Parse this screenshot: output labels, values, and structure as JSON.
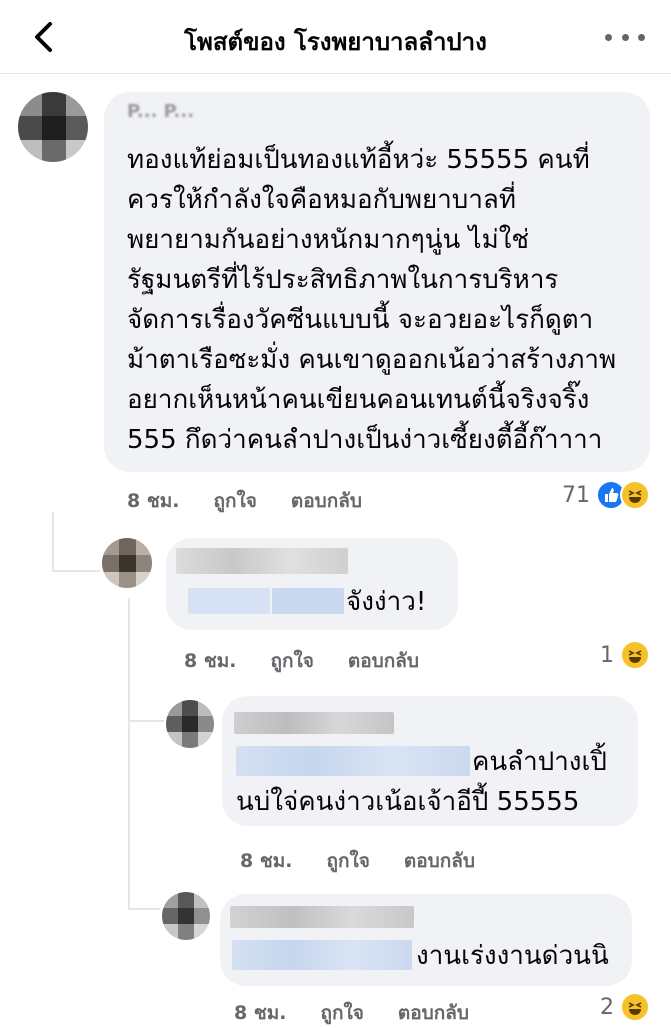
{
  "header": {
    "title": "โพสต์ของ โรงพยาบาลลำปาง",
    "back_icon": "back-chevron-icon",
    "more_icon": "more-dots-icon"
  },
  "comments": [
    {
      "author": "P... P...",
      "lines": [
        "ทองแท้ย่อมเป็นทองแท้อี้หว่ะ 55555 คนที่",
        "ควรให้กำลังใจคือหมอกับพยาบาลที่",
        "พยายามกันอย่างหนักมากๆนู่น ไม่ใช่",
        "รัฐมนตรีที่ไร้ประสิทธิภาพในการบริหาร",
        "จัดการเรื่องวัคซีนแบบนี้ จะอวยอะไรก็ดูตา",
        "ม้าตาเรือซะมั่ง คนเขาดูออกเน้อว่าสร้างภาพ",
        "อยากเห็นหน้าคนเขียนคอนเทนต์นี้จริงจริ๊ง",
        "555 กึดว่าคนลำปางเป็นง่าวเซี้ยงตี้อี้ก๊าาาา"
      ],
      "time": "8 ชม.",
      "like_label": "ถูกใจ",
      "reply_label": "ตอบกลับ",
      "reaction_count": "71",
      "reactions": [
        "like-icon",
        "haha-icon"
      ]
    },
    {
      "lines": [
        "จังง่าว!"
      ],
      "time": "8 ชม.",
      "like_label": "ถูกใจ",
      "reply_label": "ตอบกลับ",
      "reaction_count": "1",
      "reactions": [
        "haha-icon"
      ]
    },
    {
      "lines": [
        "คนลำปางเปิ้",
        "นบ่ใจ่คนง่าวเน้อเจ้าอีปี้ 55555"
      ],
      "time": "8 ชม.",
      "like_label": "ถูกใจ",
      "reply_label": "ตอบกลับ"
    },
    {
      "lines": [
        "งานเร่งงานด่วนนิ"
      ],
      "time": "8 ชม.",
      "like_label": "ถูกใจ",
      "reply_label": "ตอบกลับ",
      "reaction_count": "2",
      "reactions": [
        "haha-icon"
      ]
    }
  ],
  "colors": {
    "bubble": "#f0f2f5",
    "meta": "#65676b",
    "like": "#1877f2",
    "haha": "#f7c12c"
  }
}
